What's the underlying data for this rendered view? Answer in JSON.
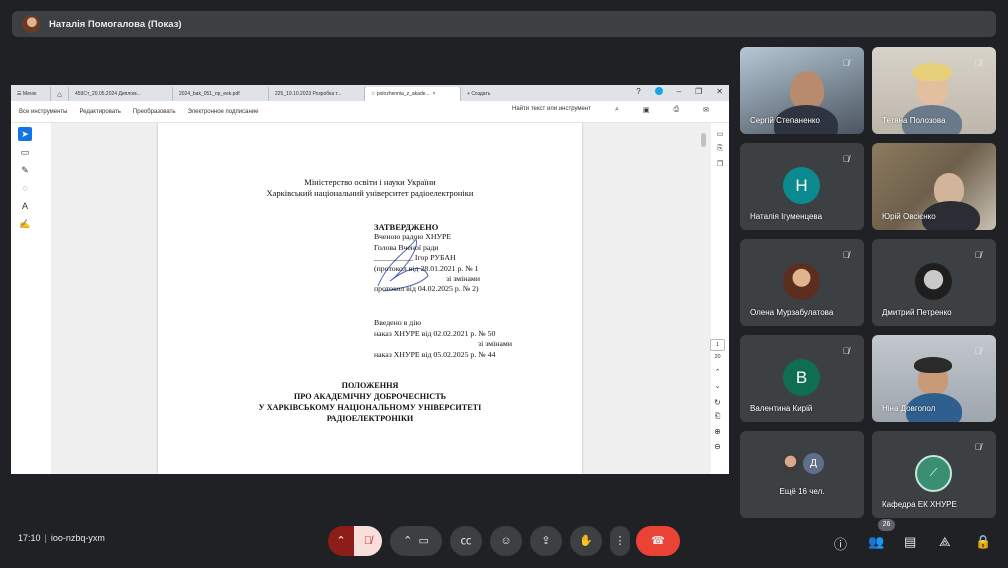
{
  "presenter": {
    "name": "Наталія Помогалова (Показ)"
  },
  "browser": {
    "tabs": [
      "Меню",
      "459Ст_20.05.2024 Диплом...",
      "2024_bak_051_np_eek.pdf",
      "225_19.10.2023 Розробка т...",
      "polozhennia_z_akade...",
      "Создать"
    ]
  },
  "pdf_toolbar": {
    "items": [
      "Все инструменты",
      "Редактировать",
      "Преобразовать",
      "Электронное подписание"
    ],
    "search": "Найти текст или инструмент"
  },
  "document": {
    "ministry_line1": "Міністерство освіти і науки України",
    "ministry_line2": "Харківський національний університет радіоелектроніки",
    "approved": "ЗАТВЕРДЖЕНО",
    "council": "Вченою радою ХНУРЕ",
    "head": "Голова Вченої ради",
    "signer": "__________ Ігор РУБАН",
    "protocol1": "(протокол від 28.01.2021 р. № 1",
    "with_changes1": "зі змінами",
    "protocol2": "протокол від 04.02.2025 р. № 2)",
    "intro": "Введено в дію",
    "order1": "наказ ХНУРЕ від 02.02.2021 р. № 50",
    "with_changes2": "зі змінами",
    "order2": "наказ ХНУРЕ від 05.02.2025 р. № 44",
    "title1": "ПОЛОЖЕННЯ",
    "title2": "ПРО АКАДЕМІЧНУ ДОБРОЧЕСНІСТЬ",
    "title3": "У ХАРКІВСЬКОМУ НАЦІОНАЛЬНОМУ УНІВЕРСИТЕТІ",
    "title4": "РАДІОЕЛЕКТРОНІКИ"
  },
  "pager": {
    "current": "1",
    "total": "20"
  },
  "participants": [
    {
      "name": "Сергій Степаненко"
    },
    {
      "name": "Тетяна Полозова"
    },
    {
      "name": "Наталія Ігуменцева",
      "letter": "Н",
      "color": "#0b8a8f"
    },
    {
      "name": "Юрій Овсієнко"
    },
    {
      "name": "Олена Мурзабулатова"
    },
    {
      "name": "Дмитрий Петренко"
    },
    {
      "name": "Валентина Кирій",
      "letter": "В",
      "color": "#0f6e4f"
    },
    {
      "name": "Ніна Довгопол"
    },
    {
      "name": "Ещё 16 чел.",
      "mini_letter": "Д"
    },
    {
      "name": "Кафедра ЕК ХНУРЕ"
    }
  ],
  "meeting": {
    "time": "17:10",
    "code": "ioo-nzbq-yxm",
    "participant_count": "26"
  }
}
